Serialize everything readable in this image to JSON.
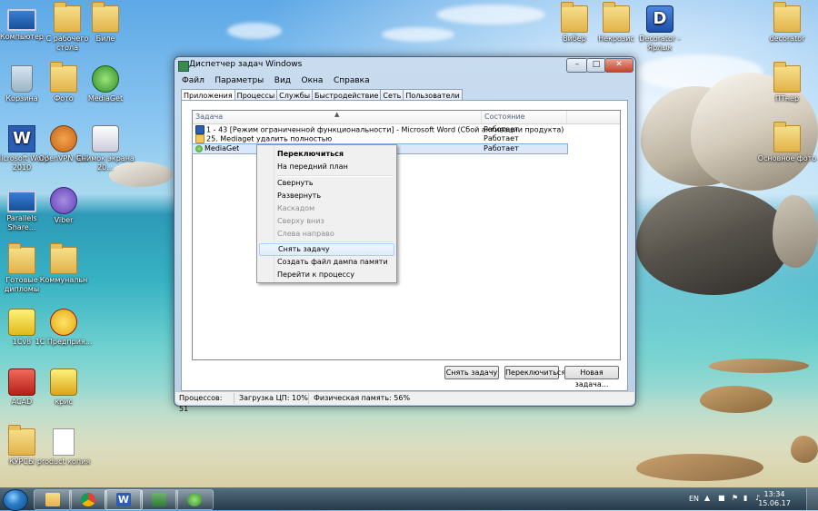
{
  "desktop": {
    "icons": [
      {
        "label": "Компьютер"
      },
      {
        "label": "С рабочего стола"
      },
      {
        "label": "Биле"
      },
      {
        "label": "Корзина"
      },
      {
        "label": "Фото"
      },
      {
        "label": "MediaGet"
      },
      {
        "label": "Microsoft Word 2010"
      },
      {
        "label": "OpenVPN GUI"
      },
      {
        "label": "Снимок экрана 20..."
      },
      {
        "label": "Parallels Share..."
      },
      {
        "label": "Viber"
      },
      {
        "label": "Готовые дипломы"
      },
      {
        "label": "Коммунальн"
      },
      {
        "label": "1Cv8"
      },
      {
        "label": "1С Предприя..."
      },
      {
        "label": "ACAD"
      },
      {
        "label": "крис"
      },
      {
        "label": "КУРСЫ"
      },
      {
        "label": "product копия"
      },
      {
        "label": "Вибер"
      },
      {
        "label": "Некрозис"
      },
      {
        "label": "Decorator - Ярлык"
      },
      {
        "label": "decorator"
      },
      {
        "label": "ПТнер"
      },
      {
        "label": "Основное фото"
      }
    ]
  },
  "window": {
    "title": "Диспетчер задач Windows",
    "controls": {
      "minimize": "–",
      "maximize": "□",
      "close": "✕"
    },
    "menu": [
      "Файл",
      "Параметры",
      "Вид",
      "Окна",
      "Справка"
    ],
    "tabs": [
      "Приложения",
      "Процессы",
      "Службы",
      "Быстродействие",
      "Сеть",
      "Пользователи"
    ],
    "list": {
      "headers": {
        "task": "Задача",
        "status": "Состояние"
      },
      "rows": [
        {
          "task": "1 - 43 [Режим ограниченной функциональности] - Microsoft Word (Сбой активации продукта)",
          "status": "Работает",
          "icon": "word-icon"
        },
        {
          "task": "25. Mediaget удалить полностью",
          "status": "Работает",
          "icon": "folder-icon"
        },
        {
          "task": "MediaGet",
          "status": "Работает",
          "icon": "mediaget-icon"
        }
      ]
    },
    "buttons": {
      "end_task": "Снять задачу",
      "switch_to": "Переключиться",
      "new_task": "Новая задача..."
    },
    "statusbar": {
      "processes": "Процессов: 51",
      "cpu": "Загрузка ЦП: 10%",
      "memory": "Физическая память: 56%"
    }
  },
  "context_menu": {
    "items": [
      {
        "label": "Переключиться",
        "state": "bold"
      },
      {
        "label": "На передний план",
        "state": "normal"
      },
      {
        "label": "Свернуть",
        "state": "normal"
      },
      {
        "label": "Развернуть",
        "state": "normal"
      },
      {
        "label": "Каскадом",
        "state": "disabled"
      },
      {
        "label": "Сверху вниз",
        "state": "disabled"
      },
      {
        "label": "Слева направо",
        "state": "disabled"
      },
      {
        "label": "Снять задачу",
        "state": "highlighted"
      },
      {
        "label": "Создать файл дампа памяти",
        "state": "normal"
      },
      {
        "label": "Перейти к процессу",
        "state": "normal"
      }
    ]
  },
  "taskbar": {
    "language": "EN",
    "time": "13:34",
    "date": "15.06.17"
  },
  "colors": {
    "accent": "#3c7fb1",
    "selection": "#dbe8f9",
    "menu_highlight_border": "#aecff7"
  }
}
